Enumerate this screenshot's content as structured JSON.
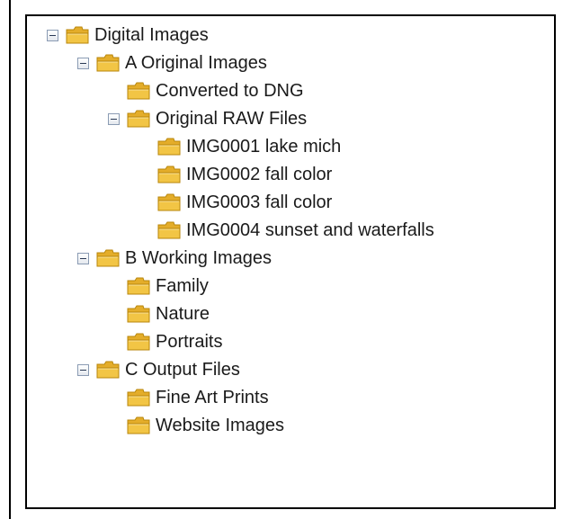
{
  "tree": {
    "items": [
      {
        "label": "Digital Images",
        "level": 0,
        "expandable": true
      },
      {
        "label": "A Original Images",
        "level": 1,
        "expandable": true
      },
      {
        "label": "Converted to DNG",
        "level": 2,
        "expandable": false
      },
      {
        "label": "Original RAW Files",
        "level": 2,
        "expandable": true
      },
      {
        "label": "IMG0001 lake mich",
        "level": 3,
        "expandable": false
      },
      {
        "label": "IMG0002 fall color",
        "level": 3,
        "expandable": false
      },
      {
        "label": "IMG0003 fall color",
        "level": 3,
        "expandable": false
      },
      {
        "label": "IMG0004 sunset and waterfalls",
        "level": 3,
        "expandable": false
      },
      {
        "label": "B Working Images",
        "level": 1,
        "expandable": true
      },
      {
        "label": "Family",
        "level": 2,
        "expandable": false
      },
      {
        "label": "Nature",
        "level": 2,
        "expandable": false
      },
      {
        "label": "Portraits",
        "level": 2,
        "expandable": false
      },
      {
        "label": "C Output Files",
        "level": 1,
        "expandable": true
      },
      {
        "label": "Fine Art Prints",
        "level": 2,
        "expandable": false
      },
      {
        "label": "Website Images",
        "level": 2,
        "expandable": false
      }
    ]
  },
  "colors": {
    "folder_body": "#f2c545",
    "folder_tab": "#e4ad2a",
    "folder_outline": "#b8860b"
  },
  "icons": {
    "folder": "folder-icon",
    "toggle": "collapse-toggle-icon"
  }
}
